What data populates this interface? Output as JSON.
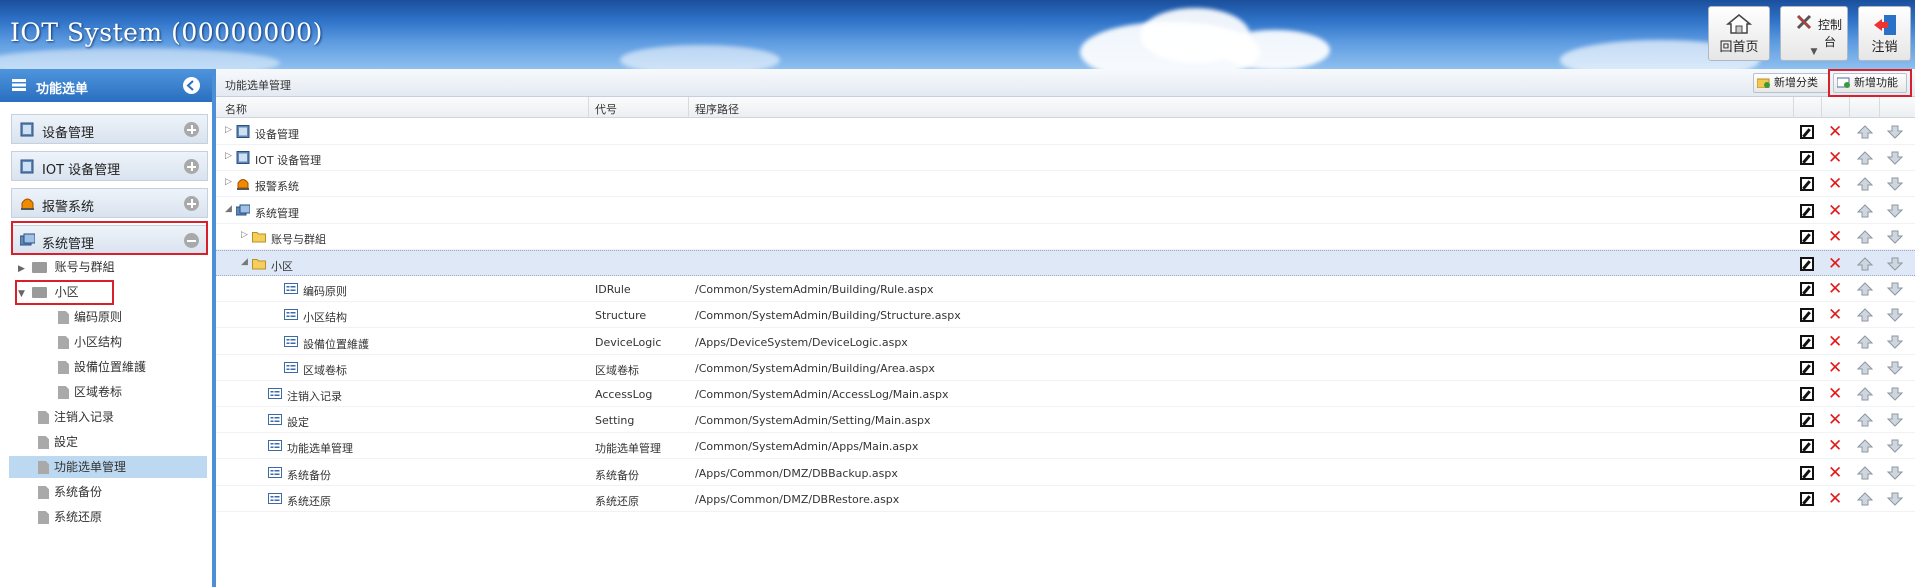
{
  "header": {
    "title": "IOT System (00000000)",
    "home_label": "回首页",
    "control_label": "控制台",
    "logout_label": "注销"
  },
  "sidebar": {
    "title": "功能选单",
    "sections": [
      {
        "label": "设备管理"
      },
      {
        "label": "IOT 设备管理"
      },
      {
        "label": "报警系统"
      },
      {
        "label": "系统管理"
      }
    ],
    "tree": [
      {
        "label": "账号与群組"
      },
      {
        "label": "小区"
      },
      {
        "label": "编码原则"
      },
      {
        "label": "小区结构"
      },
      {
        "label": "設備位置維護"
      },
      {
        "label": "区域卷标"
      },
      {
        "label": "注销入记录"
      },
      {
        "label": "設定"
      },
      {
        "label": "功能选单管理"
      },
      {
        "label": "系统备份"
      },
      {
        "label": "系统还原"
      }
    ]
  },
  "main": {
    "title": "功能选单管理",
    "add_category_label": "新增分类",
    "add_function_label": "新增功能",
    "columns": {
      "name": "名称",
      "code": "代号",
      "path": "程序路径"
    },
    "rows": [
      {
        "name": "设备管理",
        "code": "",
        "path": ""
      },
      {
        "name": "IOT 设备管理",
        "code": "",
        "path": ""
      },
      {
        "name": "报警系统",
        "code": "",
        "path": ""
      },
      {
        "name": "系统管理",
        "code": "",
        "path": ""
      },
      {
        "name": "账号与群組",
        "code": "",
        "path": ""
      },
      {
        "name": "小区",
        "code": "",
        "path": ""
      },
      {
        "name": "编码原则",
        "code": "IDRule",
        "path": "/Common/SystemAdmin/Building/Rule.aspx"
      },
      {
        "name": "小区结构",
        "code": "Structure",
        "path": "/Common/SystemAdmin/Building/Structure.aspx"
      },
      {
        "name": "設備位置維護",
        "code": "DeviceLogic",
        "path": "/Apps/DeviceSystem/DeviceLogic.aspx"
      },
      {
        "name": "区域卷标",
        "code": "区域卷标",
        "path": "/Common/SystemAdmin/Building/Area.aspx"
      },
      {
        "name": "注销入记录",
        "code": "AccessLog",
        "path": "/Common/SystemAdmin/AccessLog/Main.aspx"
      },
      {
        "name": "設定",
        "code": "Setting",
        "path": "/Common/SystemAdmin/Setting/Main.aspx"
      },
      {
        "name": "功能选单管理",
        "code": "功能选单管理",
        "path": "/Common/SystemAdmin/Apps/Main.aspx"
      },
      {
        "name": "系统备份",
        "code": "系统备份",
        "path": "/Apps/Common/DMZ/DBBackup.aspx"
      },
      {
        "name": "系统还原",
        "code": "系统还原",
        "path": "/Apps/Common/DMZ/DBRestore.aspx"
      }
    ]
  }
}
